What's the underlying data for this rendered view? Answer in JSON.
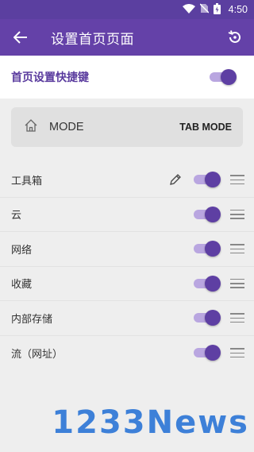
{
  "status_bar": {
    "time": "4:50",
    "icons": [
      "wifi-icon",
      "no-sim-icon",
      "battery-icon"
    ]
  },
  "app_bar": {
    "title": "设置首页页面",
    "back_icon": "arrow-back-icon",
    "reset_icon": "restore-icon"
  },
  "master_toggle": {
    "label": "首页设置快捷键",
    "on": true
  },
  "mode_card": {
    "icon": "home-icon",
    "label": "MODE",
    "action": "TAB MODE"
  },
  "items": [
    {
      "label": "工具箱",
      "enabled": true,
      "editable": true
    },
    {
      "label": "云",
      "enabled": true,
      "editable": false
    },
    {
      "label": "网络",
      "enabled": true,
      "editable": false
    },
    {
      "label": "收藏",
      "enabled": true,
      "editable": false
    },
    {
      "label": "内部存储",
      "enabled": true,
      "editable": false
    },
    {
      "label": "流（网址）",
      "enabled": true,
      "editable": false
    }
  ],
  "watermark": "1233News",
  "colors": {
    "app_bar": "#6441a8",
    "status_bar": "#5b3fa0",
    "accent": "#5e3fa3",
    "switch_track": "#b9a6e0",
    "content_bg": "#eeeeee"
  }
}
